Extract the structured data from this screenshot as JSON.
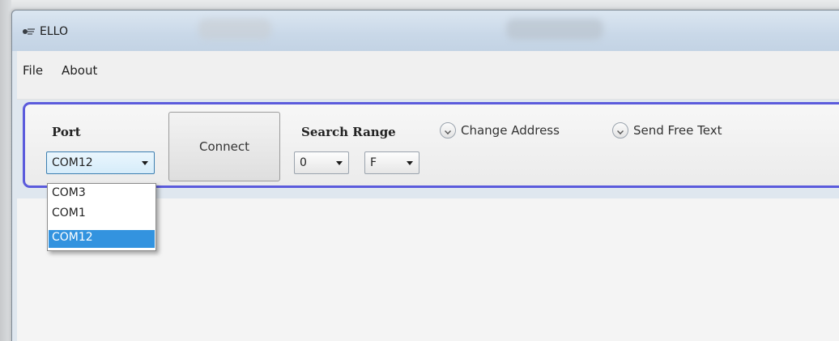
{
  "window": {
    "title": "ELLO"
  },
  "menu": {
    "items": [
      "File",
      "About"
    ]
  },
  "toolbar": {
    "port_label": "Port",
    "port_selected": "COM12",
    "connect_label": "Connect",
    "search_range_label": "Search Range",
    "range_from": "0",
    "range_to": "F",
    "change_address_label": "Change Address",
    "send_free_text_label": "Send Free Text"
  },
  "port_dropdown": {
    "options": [
      "COM3",
      "COM1",
      "COM12"
    ],
    "selected_index": 2
  },
  "colors": {
    "accent_border": "#5b5bdc",
    "selection": "#3393df"
  },
  "icons": {
    "app": "app-icon",
    "combo_arrow": "chevron-down-icon",
    "expander": "expander-chevron-icon"
  }
}
